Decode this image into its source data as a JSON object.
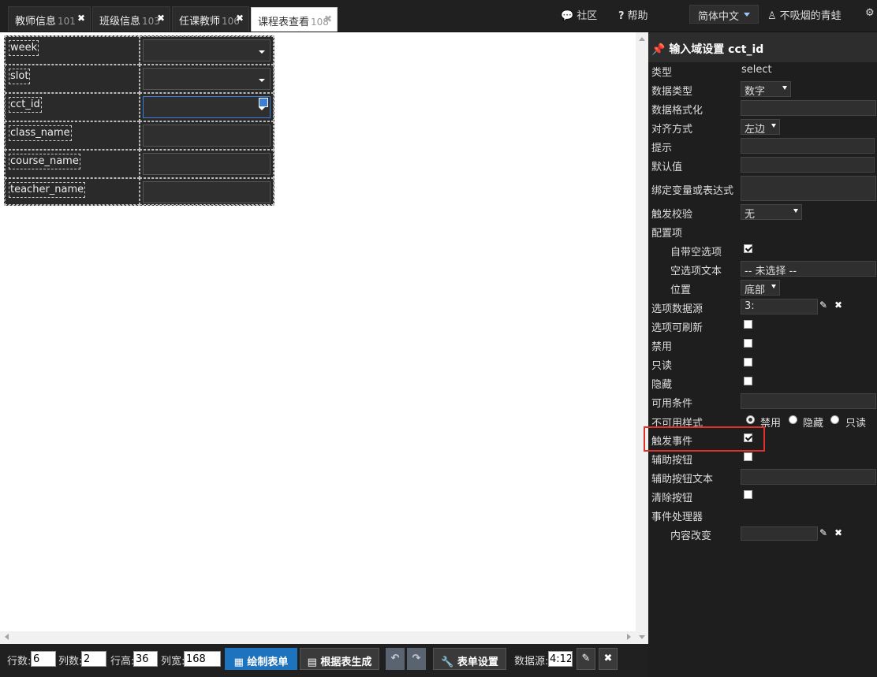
{
  "tabs": [
    {
      "label": "教师信息",
      "num": "101",
      "active": false
    },
    {
      "label": "班级信息",
      "num": "103",
      "active": false
    },
    {
      "label": "任课教师",
      "num": "106",
      "active": false
    },
    {
      "label": "课程表查看",
      "num": "108",
      "active": true
    }
  ],
  "topnav": {
    "community": "社区",
    "help": "帮助",
    "language": "简体中文",
    "user": "不吸烟的青蛙"
  },
  "form_fields": [
    {
      "label": "week",
      "type": "select"
    },
    {
      "label": "slot",
      "type": "select"
    },
    {
      "label": "cct_id",
      "type": "select"
    },
    {
      "label": "class_name",
      "type": "text"
    },
    {
      "label": "course_name",
      "type": "text"
    },
    {
      "label": "teacher_name",
      "type": "text"
    }
  ],
  "bottom": {
    "rows_label": "行数:",
    "rows_value": "6",
    "cols_label": "列数:",
    "cols_value": "2",
    "row_height_label": "行高:",
    "row_height_value": "36",
    "col_width_label": "列宽:",
    "col_width_value": "168",
    "draw_form": "绘制表单",
    "gen_from_table": "根据表生成",
    "form_settings": "表单设置",
    "datasource_label": "数据源:",
    "datasource_value": "4:12"
  },
  "panel": {
    "title": "输入域设置 cct_id",
    "type_label": "类型",
    "type_value": "select",
    "datatype_label": "数据类型",
    "datatype_value": "数字",
    "format_label": "数据格式化",
    "align_label": "对齐方式",
    "align_value": "左边",
    "hint_label": "提示",
    "default_label": "默认值",
    "bind_label": "绑定变量或表达式",
    "validate_label": "触发校验",
    "validate_value": "无",
    "config_label": "配置项",
    "empty_option_label": "自带空选项",
    "empty_option_checked": true,
    "empty_text_label": "空选项文本",
    "empty_text_value": "-- 未选择 --",
    "position_label": "位置",
    "position_value": "底部",
    "options_source_label": "选项数据源",
    "options_source_value": "3:",
    "refreshable_label": "选项可刷新",
    "disabled_label": "禁用",
    "readonly_label": "只读",
    "hidden_label": "隐藏",
    "available_label": "可用条件",
    "unavail_style_label": "不可用样式",
    "unavail_opts": [
      "禁用",
      "隐藏",
      "只读"
    ],
    "trigger_event_label": "触发事件",
    "trigger_event_checked": true,
    "aux_button_label": "辅助按钮",
    "aux_button_text_label": "辅助按钮文本",
    "clear_button_label": "清除按钮",
    "event_handler_label": "事件处理器",
    "content_change_label": "内容改变"
  }
}
